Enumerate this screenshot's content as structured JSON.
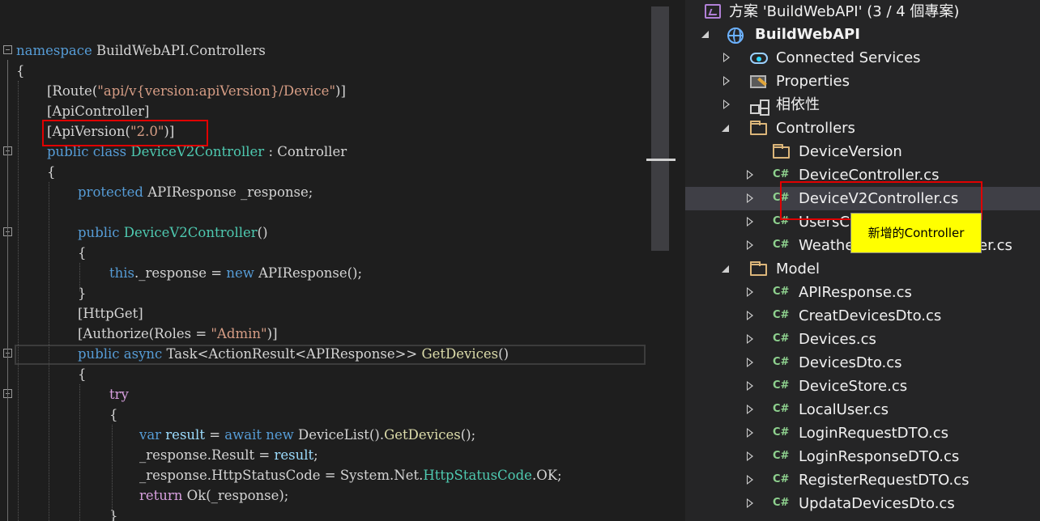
{
  "editor": {
    "lines": [
      {
        "tokens": [
          {
            "t": "namespace",
            "c": "kw"
          },
          {
            "t": " BuildWebAPI.Controllers"
          }
        ]
      },
      {
        "tokens": [
          {
            "t": "{"
          }
        ]
      },
      {
        "tokens": [
          {
            "t": "[Route("
          },
          {
            "t": "\"api/v{version:apiVersion}/Device\"",
            "c": "st"
          },
          {
            "t": ")]"
          }
        ]
      },
      {
        "tokens": [
          {
            "t": "[ApiController]"
          }
        ]
      },
      {
        "tokens": [
          {
            "t": "[ApiVersion("
          },
          {
            "t": "\"2.0\"",
            "c": "st"
          },
          {
            "t": ")]"
          }
        ]
      },
      {
        "tokens": [
          {
            "t": "public",
            "c": "kw"
          },
          {
            "t": " "
          },
          {
            "t": "class",
            "c": "kw"
          },
          {
            "t": " "
          },
          {
            "t": "DeviceV2Controller",
            "c": "ty"
          },
          {
            "t": " : Controller"
          }
        ]
      },
      {
        "tokens": [
          {
            "t": "{"
          }
        ]
      },
      {
        "tokens": [
          {
            "t": "protected",
            "c": "kw"
          },
          {
            "t": " APIResponse _response;"
          }
        ]
      },
      {
        "tokens": []
      },
      {
        "tokens": [
          {
            "t": "public",
            "c": "kw"
          },
          {
            "t": " "
          },
          {
            "t": "DeviceV2Controller",
            "c": "ty"
          },
          {
            "t": "()"
          }
        ]
      },
      {
        "tokens": [
          {
            "t": "{"
          }
        ]
      },
      {
        "tokens": [
          {
            "t": "this",
            "c": "kw"
          },
          {
            "t": "._response = "
          },
          {
            "t": "new",
            "c": "kw"
          },
          {
            "t": " APIResponse();"
          }
        ]
      },
      {
        "tokens": [
          {
            "t": "}"
          }
        ]
      },
      {
        "tokens": [
          {
            "t": "[HttpGet]"
          }
        ]
      },
      {
        "tokens": [
          {
            "t": "[Authorize(Roles = "
          },
          {
            "t": "\"Admin\"",
            "c": "st"
          },
          {
            "t": ")]"
          }
        ]
      },
      {
        "tokens": [
          {
            "t": "public",
            "c": "kw"
          },
          {
            "t": " "
          },
          {
            "t": "async",
            "c": "kw"
          },
          {
            "t": " Task<ActionResult<APIResponse>> "
          },
          {
            "t": "GetDevices",
            "c": "fn"
          },
          {
            "t": "()"
          }
        ]
      },
      {
        "tokens": [
          {
            "t": "{"
          }
        ]
      },
      {
        "tokens": [
          {
            "t": "try",
            "c": "ctl"
          }
        ]
      },
      {
        "tokens": [
          {
            "t": "{"
          }
        ]
      },
      {
        "tokens": [
          {
            "t": "var",
            "c": "kw"
          },
          {
            "t": " "
          },
          {
            "t": "result",
            "c": "var"
          },
          {
            "t": " = "
          },
          {
            "t": "await",
            "c": "kw"
          },
          {
            "t": " "
          },
          {
            "t": "new",
            "c": "kw"
          },
          {
            "t": " DeviceList()."
          },
          {
            "t": "GetDevices",
            "c": "fn"
          },
          {
            "t": "();"
          }
        ]
      },
      {
        "tokens": [
          {
            "t": "_response.Result = "
          },
          {
            "t": "result",
            "c": "var"
          },
          {
            "t": ";"
          }
        ]
      },
      {
        "tokens": [
          {
            "t": "_response.HttpStatusCode = System.Net."
          },
          {
            "t": "HttpStatusCode",
            "c": "ty"
          },
          {
            "t": ".OK;"
          }
        ]
      },
      {
        "tokens": [
          {
            "t": "return",
            "c": "ctl"
          },
          {
            "t": " Ok(_response);"
          }
        ]
      },
      {
        "tokens": [
          {
            "t": "}"
          }
        ]
      }
    ]
  },
  "solution_explorer": {
    "solution_title": "方案 'BuildWebAPI' (3 / 4 個專案)",
    "items": [
      {
        "label": "BuildWebAPI",
        "icon": "globe-icon",
        "expander": "down",
        "bold": true
      },
      {
        "label": "Connected Services",
        "icon": "cloud-icon",
        "expander": "right"
      },
      {
        "label": "Properties",
        "icon": "wrench-icon",
        "expander": "right"
      },
      {
        "label": "相依性",
        "icon": "dependencies-icon",
        "expander": "right"
      },
      {
        "label": "Controllers",
        "icon": "folder-icon",
        "expander": "down"
      },
      {
        "label": "DeviceVersion",
        "icon": "folder-icon",
        "expander": "none"
      },
      {
        "label": "DeviceController.cs",
        "icon": "csharp-icon",
        "expander": "right"
      },
      {
        "label": "DeviceV2Controller.cs",
        "icon": "csharp-icon",
        "expander": "right",
        "selected": true
      },
      {
        "label": "UsersController.cs",
        "icon": "csharp-icon",
        "expander": "right"
      },
      {
        "label": "WeatherForecastController.cs",
        "icon": "csharp-icon",
        "expander": "right"
      },
      {
        "label": "Model",
        "icon": "folder-icon",
        "expander": "down"
      },
      {
        "label": "APIResponse.cs",
        "icon": "csharp-icon",
        "expander": "right"
      },
      {
        "label": "CreatDevicesDto.cs",
        "icon": "csharp-icon",
        "expander": "right"
      },
      {
        "label": "Devices.cs",
        "icon": "csharp-icon",
        "expander": "right"
      },
      {
        "label": "DevicesDto.cs",
        "icon": "csharp-icon",
        "expander": "right"
      },
      {
        "label": "DeviceStore.cs",
        "icon": "csharp-icon",
        "expander": "right"
      },
      {
        "label": "LocalUser.cs",
        "icon": "csharp-icon",
        "expander": "right"
      },
      {
        "label": "LoginRequestDTO.cs",
        "icon": "csharp-icon",
        "expander": "right"
      },
      {
        "label": "LoginResponseDTO.cs",
        "icon": "csharp-icon",
        "expander": "right"
      },
      {
        "label": "RegisterRequestDTO.cs",
        "icon": "csharp-icon",
        "expander": "right"
      },
      {
        "label": "UpdataDevicesDto.cs",
        "icon": "csharp-icon",
        "expander": "right"
      }
    ],
    "csharp_glyph": "C#"
  },
  "annotation": {
    "callout_text": "新增的Controller"
  }
}
